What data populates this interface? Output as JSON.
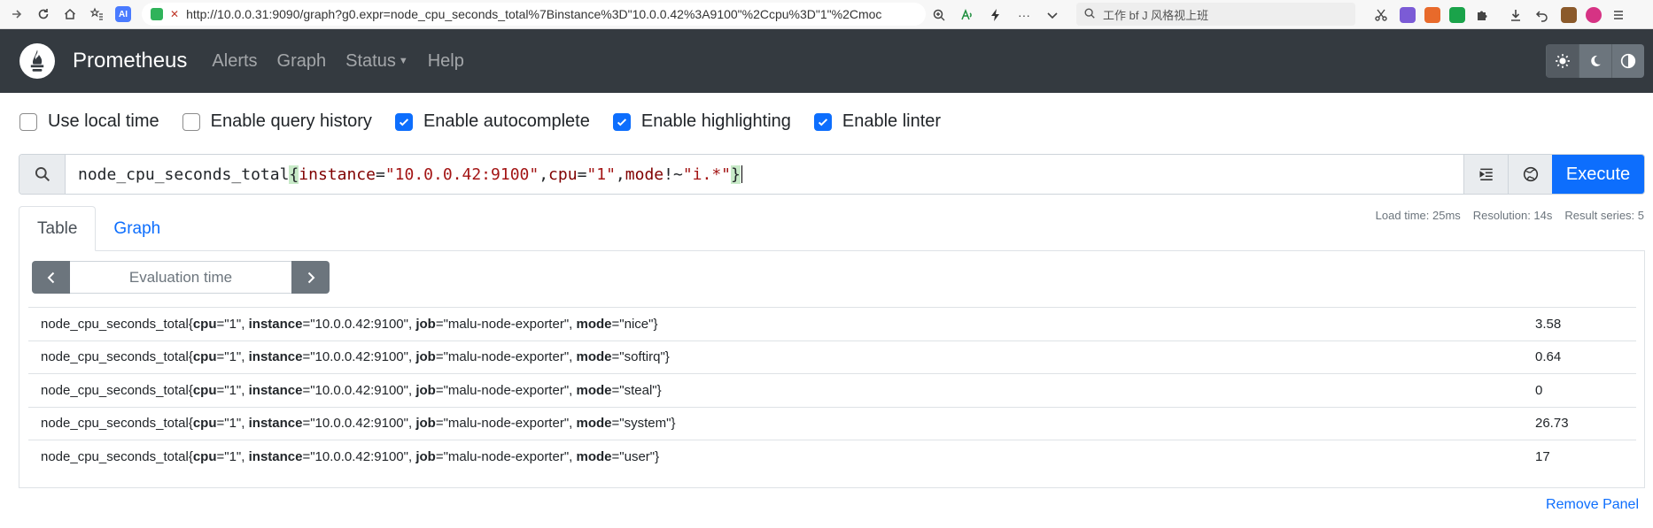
{
  "browser": {
    "url": "http://10.0.0.31:9090/graph?g0.expr=node_cpu_seconds_total%7Binstance%3D\"10.0.0.42%3A9100\"%2Ccpu%3D\"1\"%2Cmoc",
    "search_text": "工作 bf J 风格视上班",
    "ai_label": "AI"
  },
  "navbar": {
    "brand": "Prometheus",
    "links": [
      "Alerts",
      "Graph",
      "Status",
      "Help"
    ]
  },
  "options": [
    {
      "label": "Use local time",
      "checked": false
    },
    {
      "label": "Enable query history",
      "checked": false
    },
    {
      "label": "Enable autocomplete",
      "checked": true
    },
    {
      "label": "Enable highlighting",
      "checked": true
    },
    {
      "label": "Enable linter",
      "checked": true
    }
  ],
  "query": {
    "metric": "node_cpu_seconds_total",
    "open_brace": "{",
    "l1": "instance",
    "eq1": "=",
    "v1": "\"10.0.0.42:9100\"",
    "c1": ",",
    "l2": "cpu",
    "eq2": "=",
    "v2": "\"1\"",
    "c2": ",",
    "l3": "mode",
    "eq3": "!~",
    "v3": "\"i.*\"",
    "close_brace": "}",
    "execute_label": "Execute"
  },
  "tabs": [
    "Table",
    "Graph"
  ],
  "stats": {
    "load_time": "Load time: 25ms",
    "resolution": "Resolution: 14s",
    "result_series": "Result series: 5"
  },
  "eval_placeholder": "Evaluation time",
  "results": [
    {
      "metric": "node_cpu_seconds_total",
      "cpu": "\"1\"",
      "instance": "\"10.0.0.42:9100\"",
      "job": "\"malu-node-exporter\"",
      "mode": "\"nice\"",
      "value": "3.58"
    },
    {
      "metric": "node_cpu_seconds_total",
      "cpu": "\"1\"",
      "instance": "\"10.0.0.42:9100\"",
      "job": "\"malu-node-exporter\"",
      "mode": "\"softirq\"",
      "value": "0.64"
    },
    {
      "metric": "node_cpu_seconds_total",
      "cpu": "\"1\"",
      "instance": "\"10.0.0.42:9100\"",
      "job": "\"malu-node-exporter\"",
      "mode": "\"steal\"",
      "value": "0"
    },
    {
      "metric": "node_cpu_seconds_total",
      "cpu": "\"1\"",
      "instance": "\"10.0.0.42:9100\"",
      "job": "\"malu-node-exporter\"",
      "mode": "\"system\"",
      "value": "26.73"
    },
    {
      "metric": "node_cpu_seconds_total",
      "cpu": "\"1\"",
      "instance": "\"10.0.0.42:9100\"",
      "job": "\"malu-node-exporter\"",
      "mode": "\"user\"",
      "value": "17"
    }
  ],
  "result_keys": {
    "cpu": "cpu",
    "instance": "instance",
    "job": "job",
    "mode": "mode"
  },
  "remove_panel": "Remove Panel",
  "colors": {
    "accent": "#0d6efd",
    "navbar": "#343a40",
    "secondary": "#6c757d"
  }
}
